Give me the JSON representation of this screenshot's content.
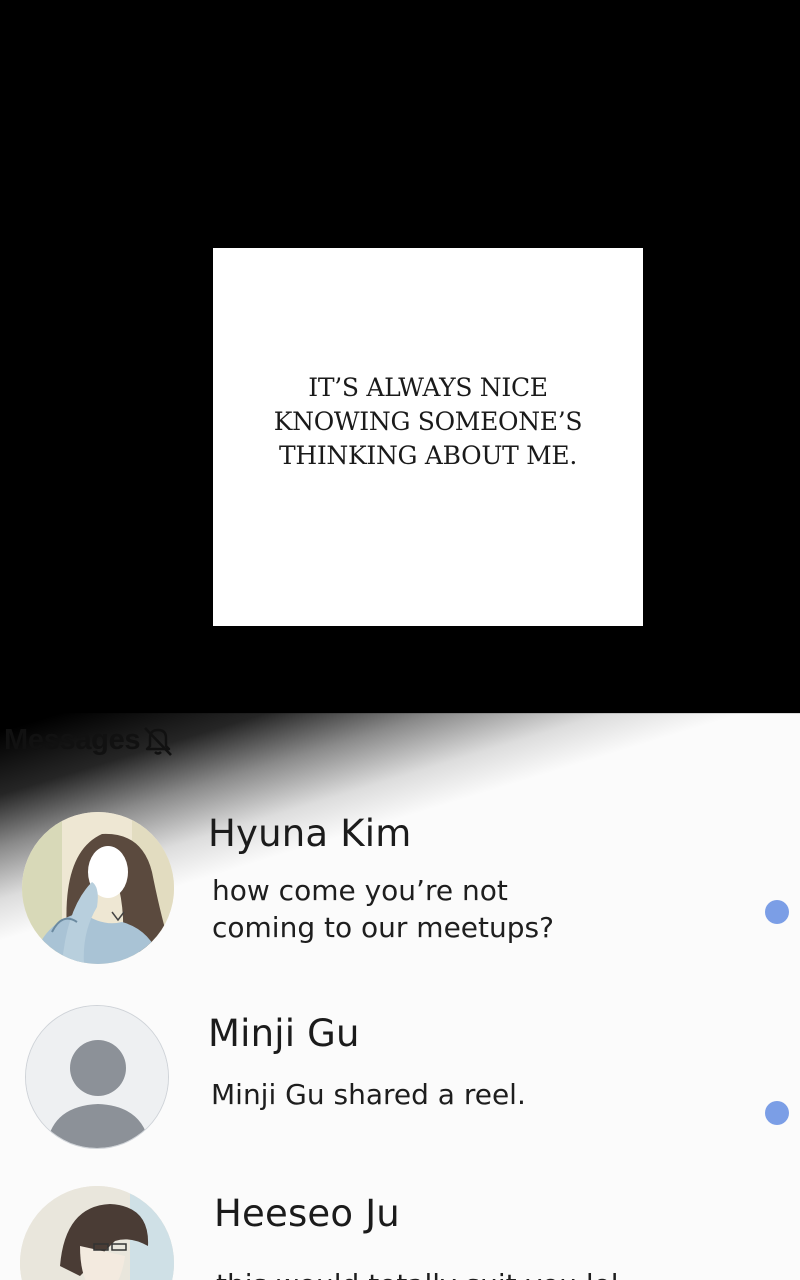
{
  "caption": {
    "text": "IT’S ALWAYS NICE\nKNOWING SOMEONE’S\nTHINKING ABOUT ME."
  },
  "messages": {
    "title": "Messages",
    "mute_icon": "bell-slash-icon",
    "threads": [
      {
        "name": "Hyuna Kim",
        "preview": "how come you’re not\ncoming to our meetups?",
        "unread": true,
        "avatar": "illustrated-girl-avatar"
      },
      {
        "name": "Minji Gu",
        "preview": "Minji Gu shared a reel.",
        "unread": true,
        "avatar": "default-person-avatar"
      },
      {
        "name": "Heeseo Ju",
        "preview": "this would totally suit you lol",
        "unread": true,
        "avatar": "illustrated-woman-avatar"
      }
    ]
  },
  "colors": {
    "unread_dot": "#7b9ee6",
    "background": "#000000",
    "screen": "#fbfbfb"
  }
}
